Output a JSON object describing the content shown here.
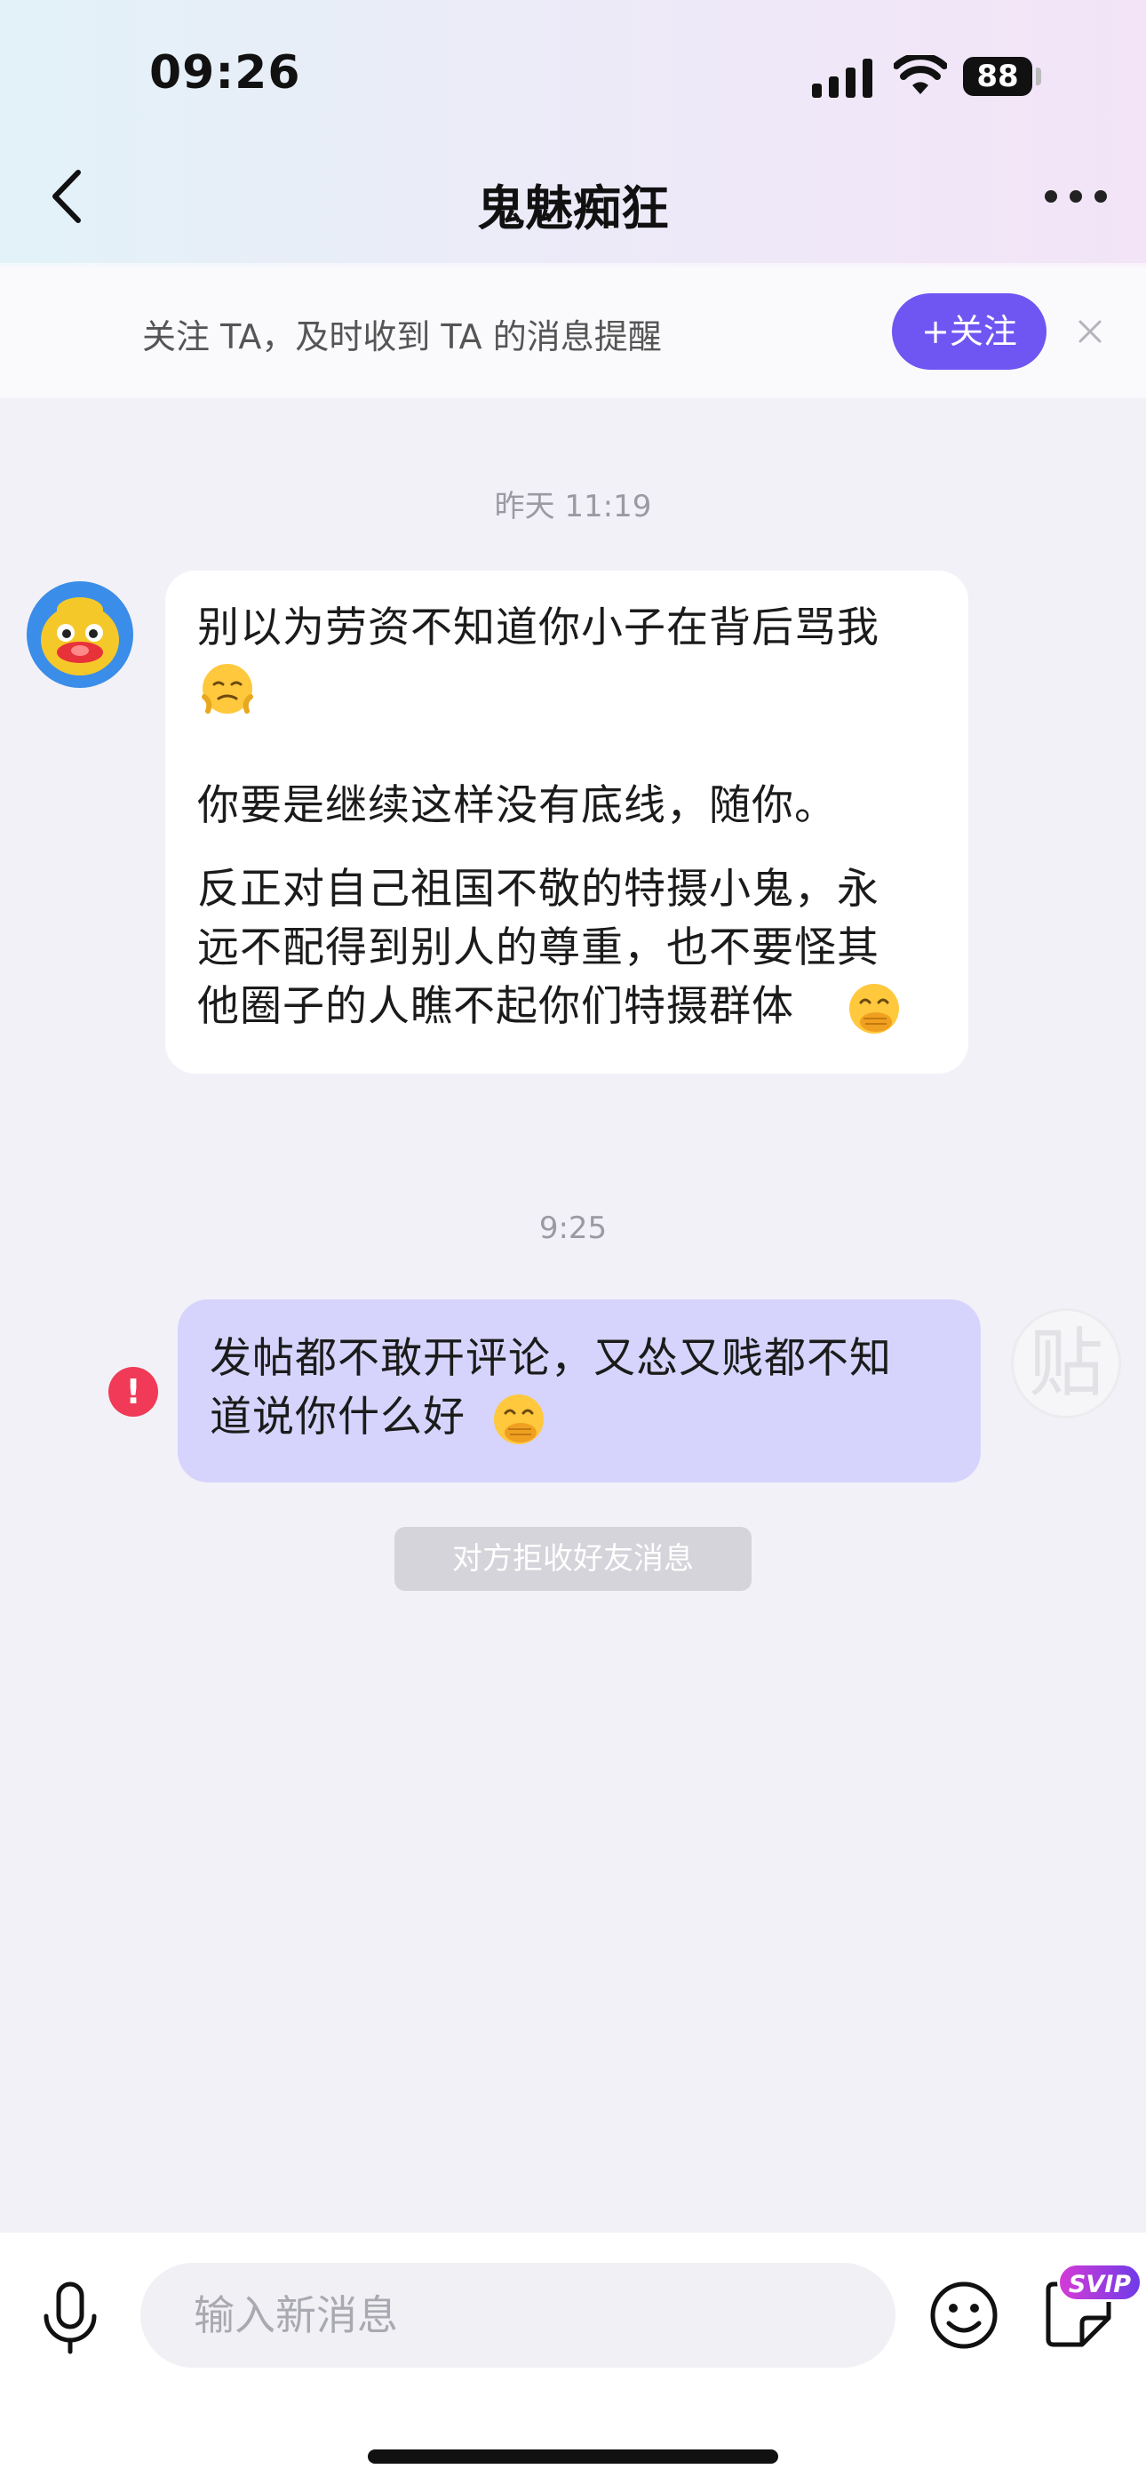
{
  "status_bar": {
    "time": "09:26",
    "battery": "88",
    "icons": [
      "signal-icon",
      "wifi-icon",
      "battery-icon"
    ]
  },
  "nav": {
    "title": "鬼魅痴狂",
    "back_icon": "chevron-left-icon",
    "more_icon": "more-horizontal-icon"
  },
  "follow_banner": {
    "text": "关注 TA，及时收到 TA 的消息提醒",
    "button_label": "+关注",
    "close_icon": "close-icon"
  },
  "messages": [
    {
      "timestamp": "昨天 11:19",
      "direction": "incoming",
      "lines": [
        "别以为劳资不知道你小子在背后骂我",
        "你要是继续这样没有底线，随你。",
        "反正对自己祖国不敬的特摄小鬼，永",
        "远不配得到别人的尊重，也不要怪其",
        "他圈子的人瞧不起你们特摄群体"
      ],
      "emojis": [
        "huffing-emoji",
        "hand-over-mouth-emoji"
      ]
    },
    {
      "timestamp": "9:25",
      "direction": "outgoing",
      "lines": [
        "发帖都不敢开评论，又怂又贱都不知",
        "道说你什么好"
      ],
      "emojis": [
        "hand-over-mouth-emoji"
      ],
      "error_icon": "!",
      "avatar_glyph": "贴"
    }
  ],
  "system_notice": "对方拒收好友消息",
  "input_bar": {
    "placeholder": "输入新消息",
    "svip_label": "SVIP",
    "icons": [
      "microphone-icon",
      "emoji-icon",
      "sticker-icon"
    ]
  },
  "colors": {
    "accent": "#6f55f2",
    "outgoing_bubble": "#d6d4fd",
    "error": "#f03a57"
  }
}
